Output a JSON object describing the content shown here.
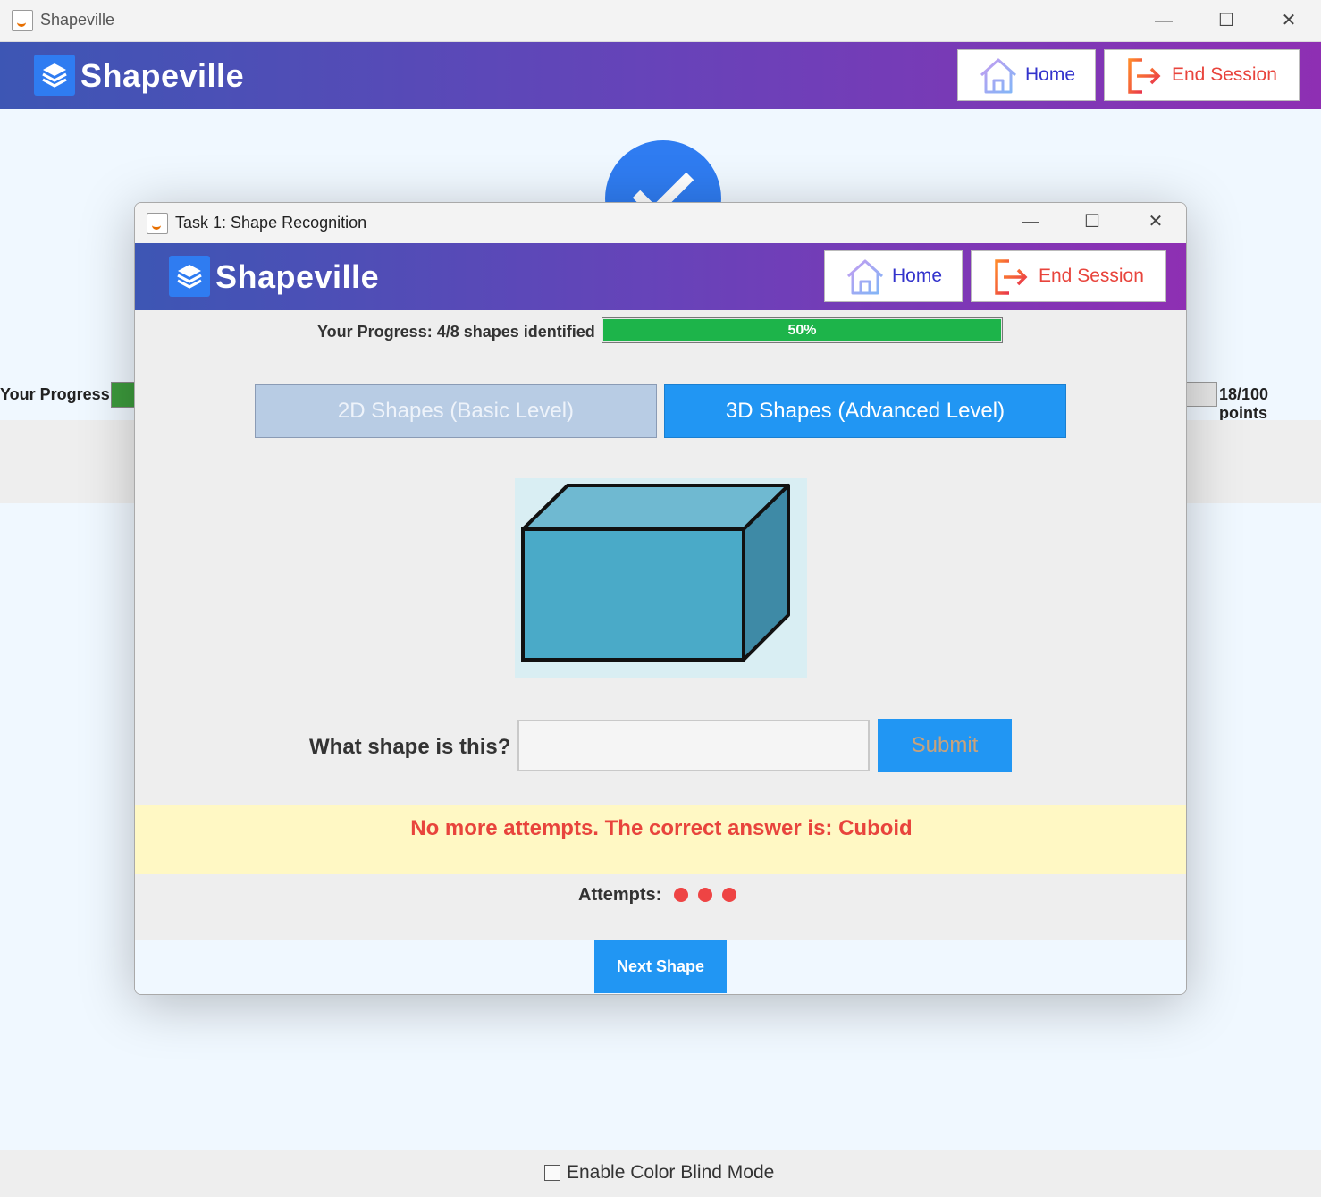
{
  "main_window": {
    "title": "Shapeville",
    "brand": "Shapeville",
    "home_label": "Home",
    "end_session_label": "End Session",
    "progress_label": "Your Progress",
    "points_label": "18/100 points",
    "color_blind_label": "Enable Color Blind Mode",
    "color_blind_checked": false
  },
  "dialog": {
    "title": "Task 1: Shape Recognition",
    "brand": "Shapeville",
    "home_label": "Home",
    "end_session_label": "End Session",
    "progress_label": "Your Progress: 4/8 shapes identified",
    "progress_text": "50%",
    "progress_fraction": 0.5,
    "tabs": [
      {
        "label": "2D Shapes (Basic Level)",
        "active": false
      },
      {
        "label": "3D Shapes (Advanced Level)",
        "active": true
      }
    ],
    "shape_image": "cuboid",
    "question_label": "What shape is this?",
    "answer_value": "",
    "submit_label": "Submit",
    "feedback": "No more attempts. The correct answer is: Cuboid",
    "attempts_label": "Attempts:",
    "attempts_used": 3,
    "next_label": "Next Shape"
  },
  "colors": {
    "header_start": "#3d56b4",
    "header_end": "#8e2fb3",
    "accent_blue": "#2196f3",
    "progress_green": "#1db44a",
    "feedback_red": "#e8443c",
    "feedback_bg": "#fff8c4"
  }
}
